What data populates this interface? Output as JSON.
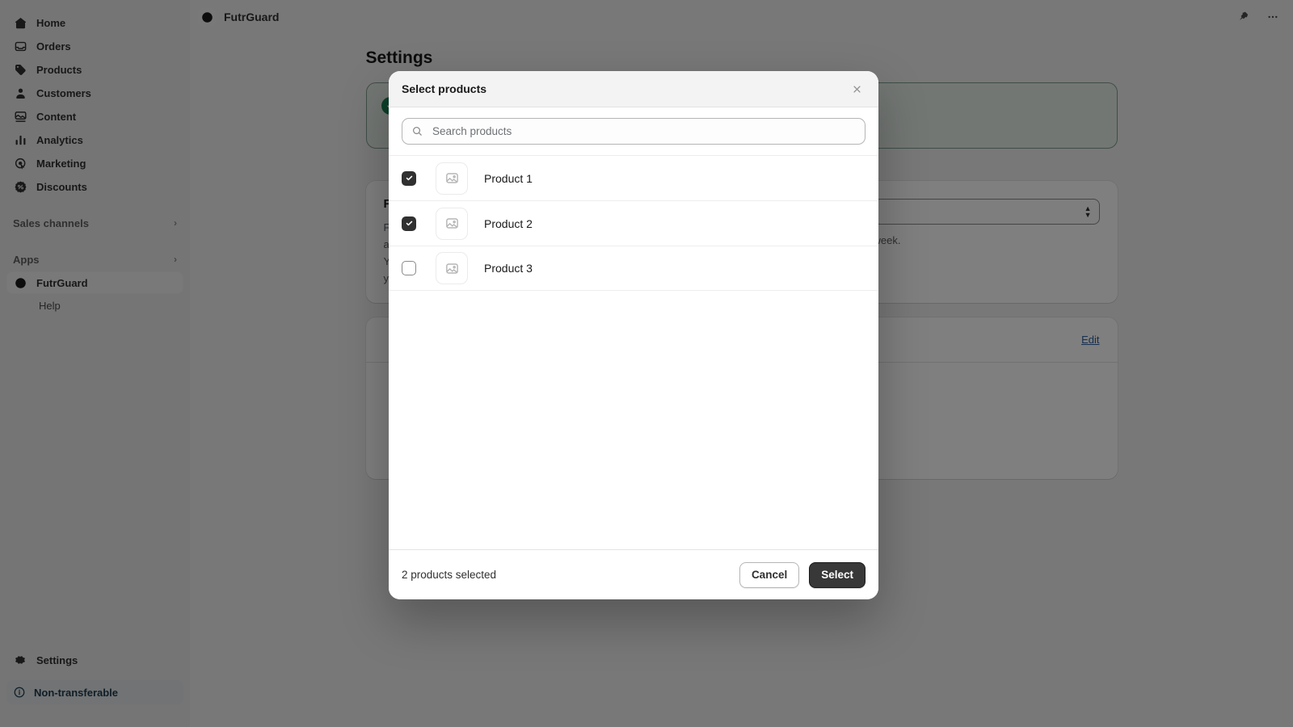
{
  "sidebar": {
    "items": [
      {
        "label": "Home",
        "icon": "home-icon"
      },
      {
        "label": "Orders",
        "icon": "orders-icon"
      },
      {
        "label": "Products",
        "icon": "products-tag-icon"
      },
      {
        "label": "Customers",
        "icon": "customers-person-icon"
      },
      {
        "label": "Content",
        "icon": "content-image-icon"
      },
      {
        "label": "Analytics",
        "icon": "analytics-bars-icon"
      },
      {
        "label": "Marketing",
        "icon": "marketing-target-icon"
      },
      {
        "label": "Discounts",
        "icon": "discounts-badge-icon"
      }
    ],
    "sales_channels": {
      "label": "Sales channels",
      "chevron": "›"
    },
    "apps": {
      "label": "Apps",
      "chevron": "›"
    },
    "app_item": {
      "label": "FutrGuard",
      "icon": "futrguard-logo-icon"
    },
    "help": {
      "label": "Help"
    },
    "settings": {
      "label": "Settings",
      "icon": "gear-icon"
    },
    "non_transferable": {
      "label": "Non-transferable",
      "icon": "info-circle-icon"
    }
  },
  "topbar": {
    "brand": "FutrGuard",
    "pin_icon": "pin-icon",
    "more_icon": "more-horizontal-icon"
  },
  "page": {
    "title": "Settings",
    "banner": {
      "icon": "success-check-icon",
      "text": ""
    },
    "card": {
      "heading": "Fak",
      "body_lines": [
        "Fak",
        "and",
        "You",
        "you"
      ],
      "hint_suffix": "week.",
      "edit_label": "Edit"
    }
  },
  "modal": {
    "title": "Select products",
    "close_icon": "close-icon",
    "search": {
      "placeholder": "Search products",
      "value": "",
      "icon": "search-icon"
    },
    "products": [
      {
        "name": "Product 1",
        "checked": true,
        "thumb_icon": "image-placeholder-icon"
      },
      {
        "name": "Product 2",
        "checked": true,
        "thumb_icon": "image-placeholder-icon"
      },
      {
        "name": "Product 3",
        "checked": false,
        "thumb_icon": "image-placeholder-icon"
      }
    ],
    "footer": {
      "selected_count": "2 products selected",
      "cancel_label": "Cancel",
      "select_label": "Select"
    }
  },
  "colors": {
    "primary_button": "#383838",
    "sidebar_bg": "#ebebeb",
    "banner_border": "#7f9e8c",
    "banner_bg": "#e6efe9",
    "success": "#1a7f55",
    "link": "#2c5f9e",
    "badge_text": "#1f3b4d"
  }
}
